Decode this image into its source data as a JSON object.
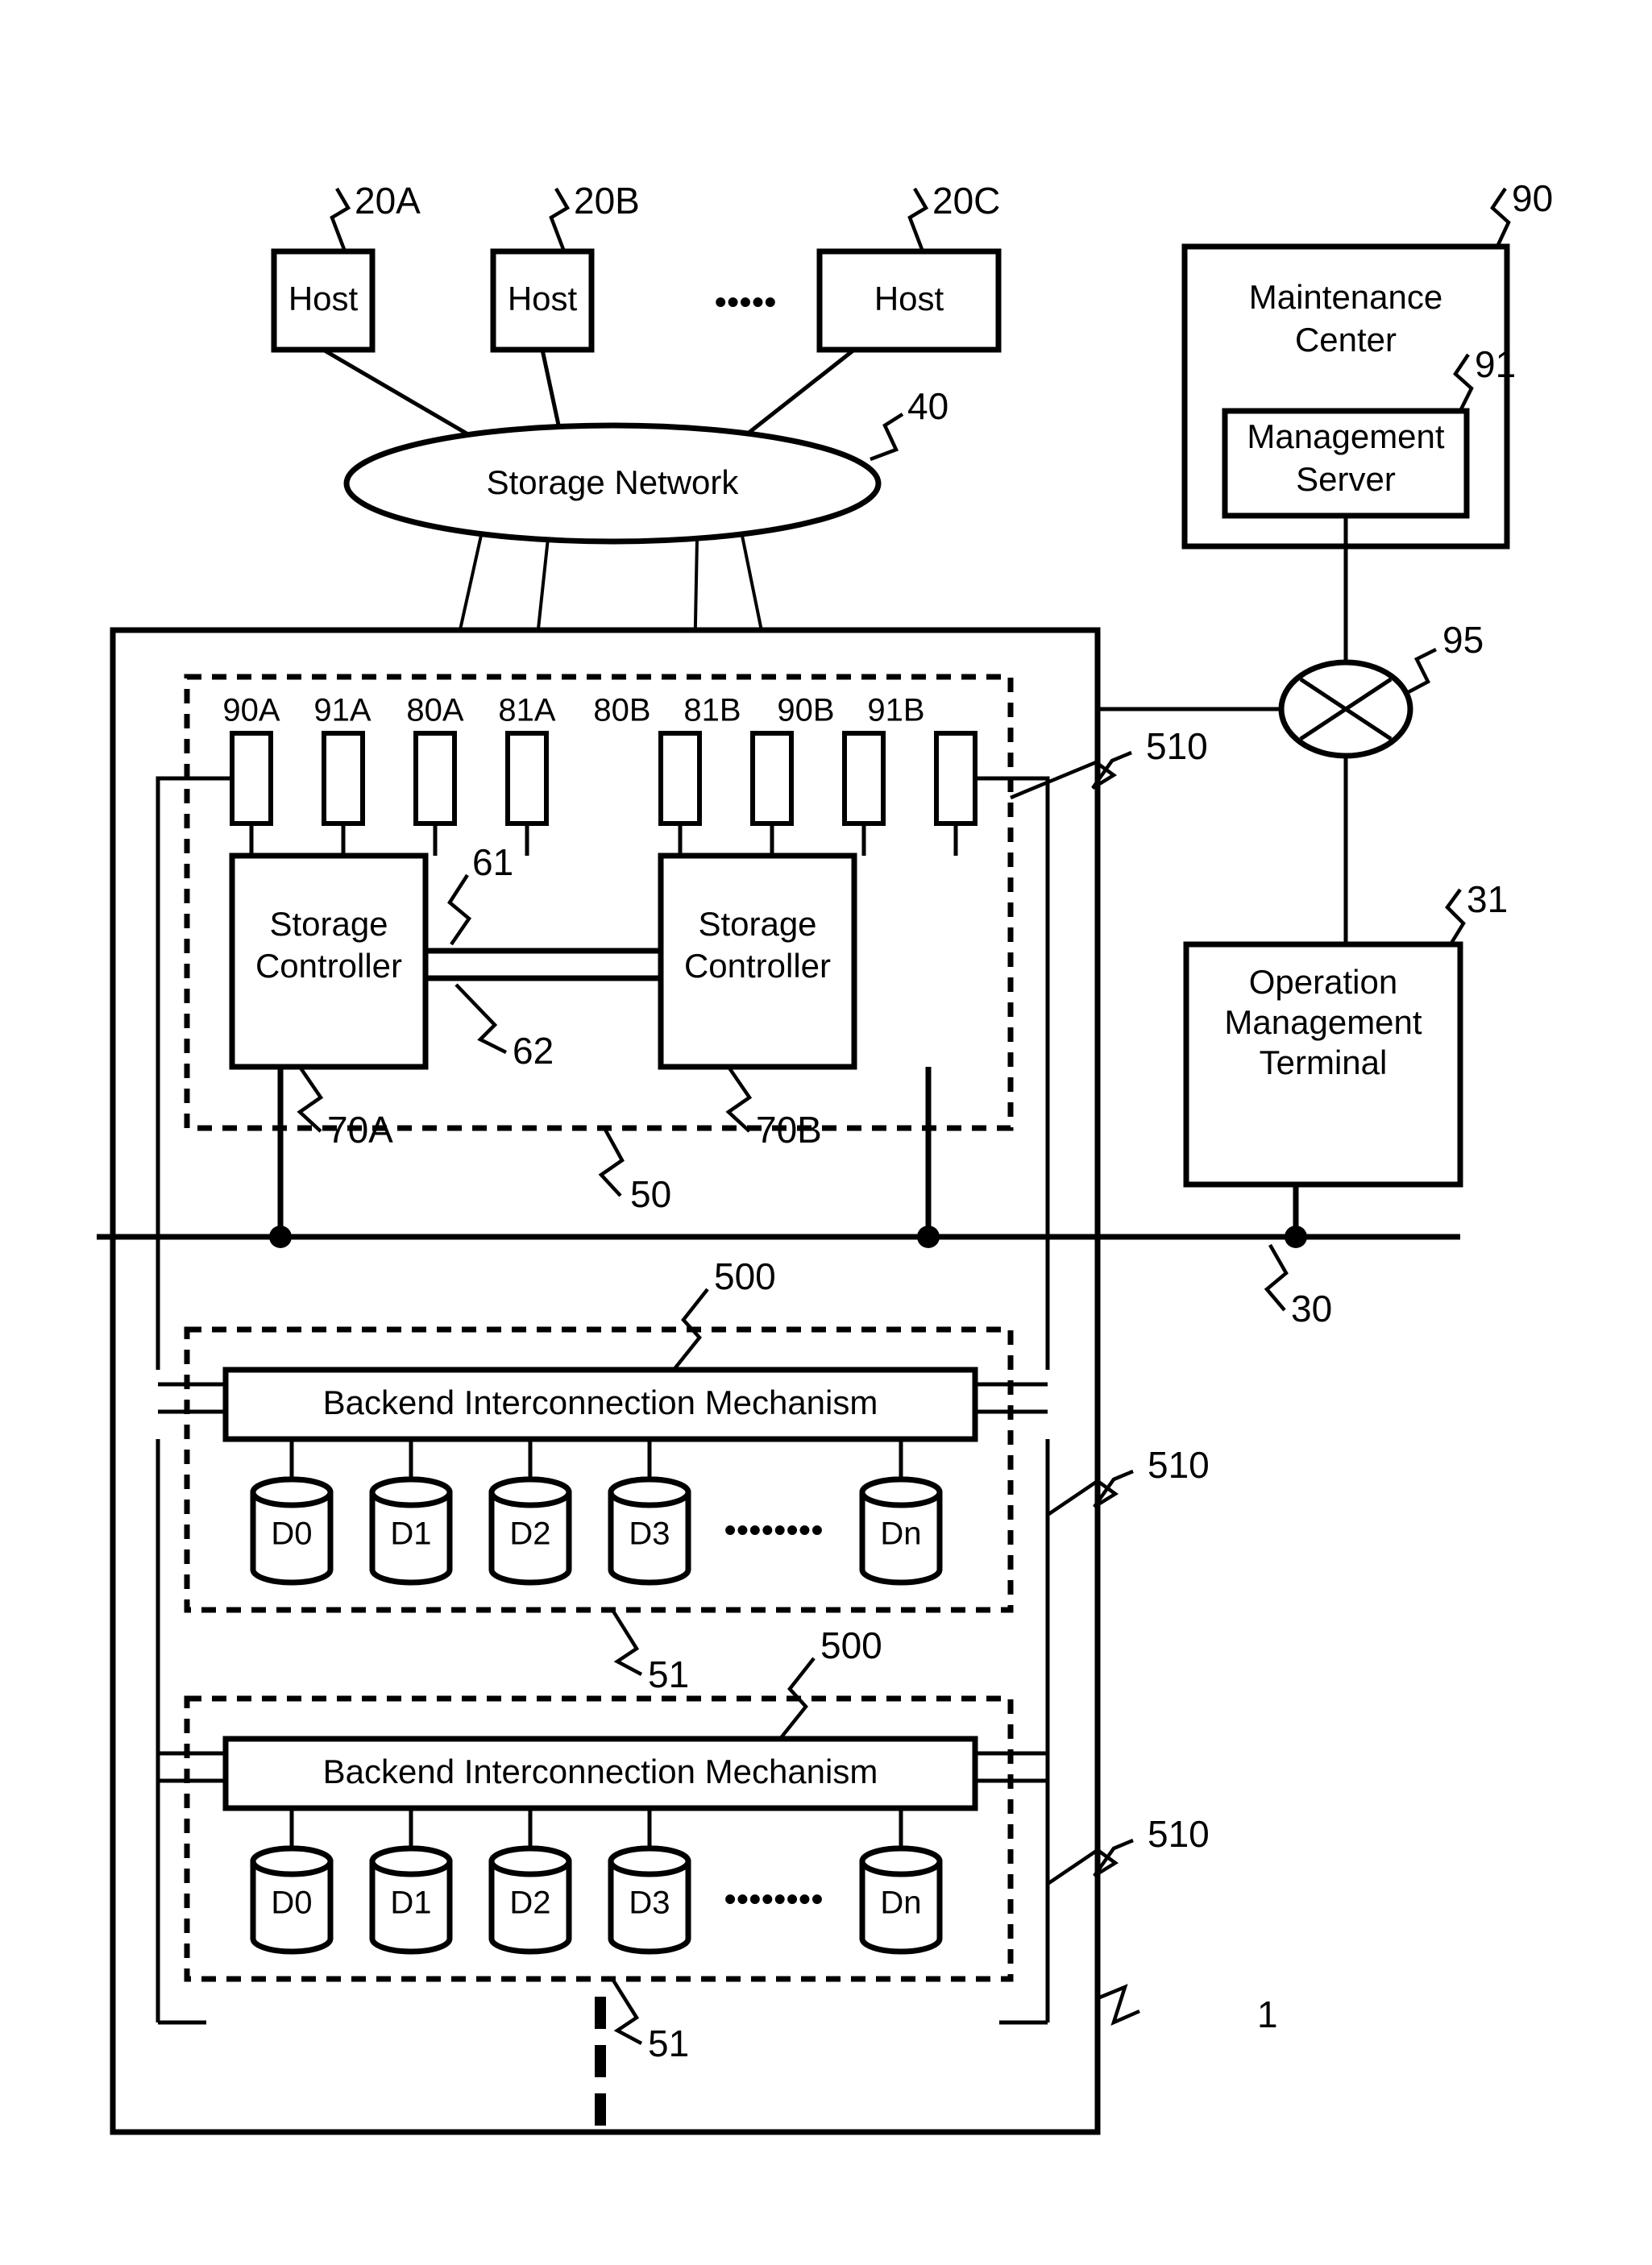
{
  "figure": {
    "type": "patent-block-diagram",
    "title": "Storage system block diagram"
  },
  "hosts": {
    "label": "Host",
    "items": [
      {
        "label": "Host",
        "ref": "20A"
      },
      {
        "label": "Host",
        "ref": "20B"
      },
      {
        "label": "Host",
        "ref": "20C"
      }
    ],
    "ellipsis": "•••••"
  },
  "storage_network": {
    "label": "Storage Network",
    "ref": "40"
  },
  "maintenance_center": {
    "label_line1": "Maintenance",
    "label_line2": "Center",
    "ref": "90",
    "management_server": {
      "label_line1": "Management",
      "label_line2": "Server",
      "ref": "91"
    }
  },
  "network_switch": {
    "ref": "95",
    "icon": "crossed-circle-icon"
  },
  "operation_management_terminal": {
    "label_line1": "Operation",
    "label_line2": "Management",
    "label_line3": "Terminal",
    "ref": "31"
  },
  "management_bus": {
    "ref": "30"
  },
  "storage_system": {
    "ref": "1"
  },
  "controller_enclosure": {
    "ref": "50",
    "ref_right": "510",
    "ports": [
      {
        "label": "90A"
      },
      {
        "label": "91A"
      },
      {
        "label": "80A"
      },
      {
        "label": "81A"
      },
      {
        "label": "80B"
      },
      {
        "label": "81B"
      },
      {
        "label": "90B"
      },
      {
        "label": "91B"
      }
    ],
    "controllers": [
      {
        "label_line1": "Storage",
        "label_line2": "Controller",
        "ref": "70A"
      },
      {
        "label_line1": "Storage",
        "label_line2": "Controller",
        "ref": "70B"
      }
    ],
    "interconnect_refs": {
      "upper": "61",
      "lower": "62"
    }
  },
  "drive_enclosures": [
    {
      "ref": "51",
      "ref_right": "510",
      "backend": {
        "label": "Backend Interconnection Mechanism",
        "ref": "500"
      },
      "disks": [
        {
          "label": "D0"
        },
        {
          "label": "D1"
        },
        {
          "label": "D2"
        },
        {
          "label": "D3"
        },
        {
          "label": "Dn"
        }
      ],
      "disk_ellipsis": "••••••••"
    },
    {
      "ref": "51",
      "ref_right": "510",
      "backend": {
        "label": "Backend Interconnection Mechanism",
        "ref": "500"
      },
      "disks": [
        {
          "label": "D0"
        },
        {
          "label": "D1"
        },
        {
          "label": "D2"
        },
        {
          "label": "D3"
        },
        {
          "label": "Dn"
        }
      ],
      "disk_ellipsis": "••••••••"
    }
  ],
  "vertical_ellipsis": "vertical-dots",
  "colors": {
    "ink": "#000000",
    "paper": "#ffffff"
  }
}
